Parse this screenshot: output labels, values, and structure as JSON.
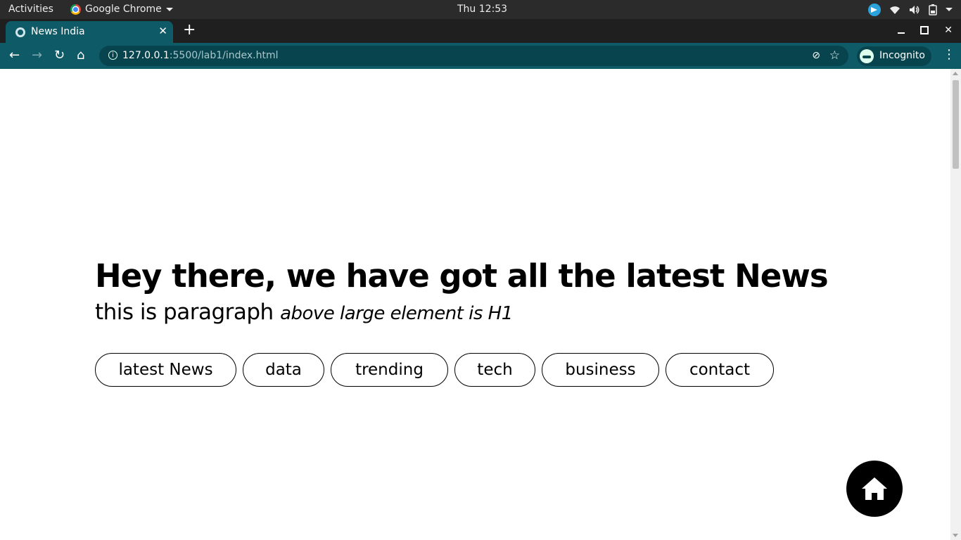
{
  "os": {
    "activities_label": "Activities",
    "app_name": "Google Chrome",
    "clock": "Thu 12:53"
  },
  "browser": {
    "tab": {
      "title": "News India"
    },
    "url": {
      "host": "127.0.0.1",
      "rest": ":5500/lab1/index.html"
    },
    "profile_label": "Incognito"
  },
  "page": {
    "heading": "Hey there, we have got all the latest News",
    "paragraph": "this is paragraph",
    "emphasis": "above large element is H1",
    "nav": [
      {
        "label": "latest News"
      },
      {
        "label": "data"
      },
      {
        "label": "trending"
      },
      {
        "label": "tech"
      },
      {
        "label": "business"
      },
      {
        "label": "contact"
      }
    ],
    "home_button_icon": "home-icon"
  },
  "colors": {
    "toolbar": "#0e5a66",
    "tabstrip": "#1f1f1f",
    "os_bar": "#2b2b2b",
    "fab": "#000000"
  }
}
